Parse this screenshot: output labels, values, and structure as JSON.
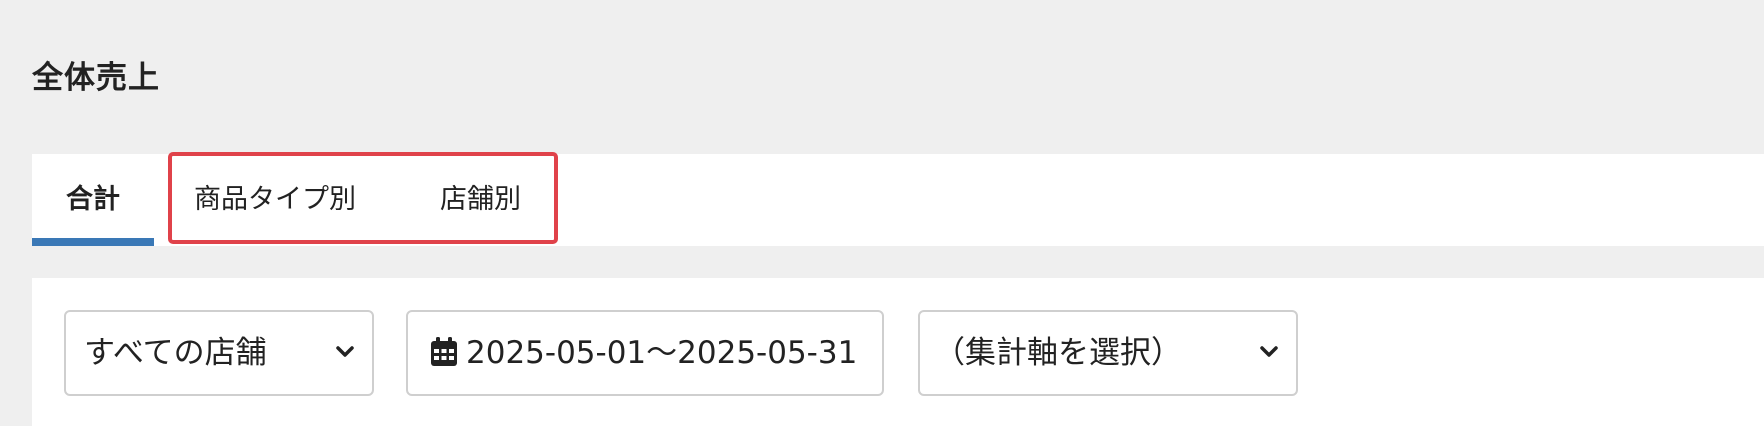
{
  "page": {
    "title": "全体売上"
  },
  "tabs": [
    {
      "label": "合計",
      "active": true
    },
    {
      "label": "商品タイプ別",
      "active": false
    },
    {
      "label": "店舗別",
      "active": false
    }
  ],
  "filters": {
    "store_select": {
      "selected": "すべての店舗",
      "icon": "chevron-down-icon"
    },
    "date_range": {
      "value": "2025-05-01〜2025-05-31",
      "icon": "calendar-icon"
    },
    "axis_select": {
      "selected": "（集計軸を選択）",
      "icon": "chevron-down-icon"
    }
  },
  "colors": {
    "background": "#efefef",
    "panel": "#ffffff",
    "active_tab_underline": "#3a78b6",
    "highlight_border": "#e0424a",
    "control_border": "#cfcfcf",
    "text": "#222222"
  }
}
